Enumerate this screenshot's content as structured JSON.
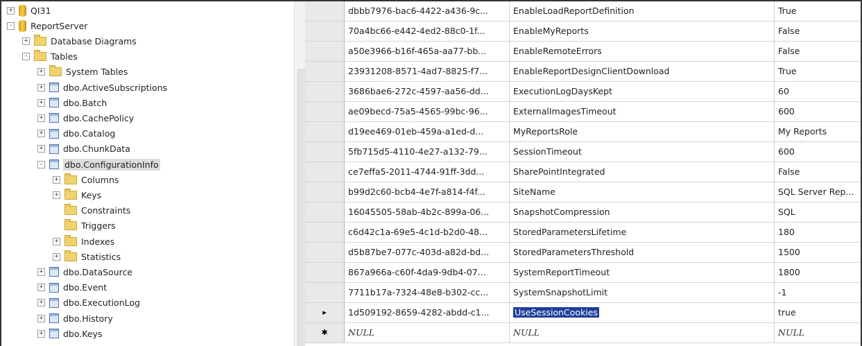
{
  "tree": {
    "nodes": [
      {
        "label": "QI31",
        "icon": "database-icon",
        "expander": "+",
        "indent": 0
      },
      {
        "label": "ReportServer",
        "icon": "database-icon",
        "expander": "-",
        "indent": 0
      },
      {
        "label": "Database Diagrams",
        "icon": "folder-icon",
        "expander": "+",
        "indent": 1
      },
      {
        "label": "Tables",
        "icon": "folder-icon",
        "expander": "-",
        "indent": 1
      },
      {
        "label": "System Tables",
        "icon": "folder-icon",
        "expander": "+",
        "indent": 2
      },
      {
        "label": "dbo.ActiveSubscriptions",
        "icon": "table-icon",
        "expander": "+",
        "indent": 2
      },
      {
        "label": "dbo.Batch",
        "icon": "table-icon",
        "expander": "+",
        "indent": 2
      },
      {
        "label": "dbo.CachePolicy",
        "icon": "table-icon",
        "expander": "+",
        "indent": 2
      },
      {
        "label": "dbo.Catalog",
        "icon": "table-icon",
        "expander": "+",
        "indent": 2
      },
      {
        "label": "dbo.ChunkData",
        "icon": "table-icon",
        "expander": "+",
        "indent": 2
      },
      {
        "label": "dbo.ConfigurationInfo",
        "icon": "table-icon",
        "expander": "-",
        "indent": 2,
        "selected": true
      },
      {
        "label": "Columns",
        "icon": "folder-icon",
        "expander": "+",
        "indent": 3
      },
      {
        "label": "Keys",
        "icon": "folder-icon",
        "expander": "+",
        "indent": 3
      },
      {
        "label": "Constraints",
        "icon": "folder-icon",
        "expander": "",
        "indent": 3
      },
      {
        "label": "Triggers",
        "icon": "folder-icon",
        "expander": "",
        "indent": 3
      },
      {
        "label": "Indexes",
        "icon": "folder-icon",
        "expander": "+",
        "indent": 3
      },
      {
        "label": "Statistics",
        "icon": "folder-icon",
        "expander": "+",
        "indent": 3
      },
      {
        "label": "dbo.DataSource",
        "icon": "table-icon",
        "expander": "+",
        "indent": 2
      },
      {
        "label": "dbo.Event",
        "icon": "table-icon",
        "expander": "+",
        "indent": 2
      },
      {
        "label": "dbo.ExecutionLog",
        "icon": "table-icon",
        "expander": "+",
        "indent": 2
      },
      {
        "label": "dbo.History",
        "icon": "table-icon",
        "expander": "+",
        "indent": 2
      },
      {
        "label": "dbo.Keys",
        "icon": "table-icon",
        "expander": "+",
        "indent": 2
      }
    ]
  },
  "grid": {
    "rows": [
      {
        "marker": "",
        "id": "dbbb7976-bac6-4422-a436-9c...",
        "name": "EnableLoadReportDefinition",
        "value": "True"
      },
      {
        "marker": "",
        "id": "70a4bc66-e442-4ed2-88c0-1f...",
        "name": "EnableMyReports",
        "value": "False"
      },
      {
        "marker": "",
        "id": "a50e3966-b16f-465a-aa77-bb...",
        "name": "EnableRemoteErrors",
        "value": "False"
      },
      {
        "marker": "",
        "id": "23931208-8571-4ad7-8825-f7...",
        "name": "EnableReportDesignClientDownload",
        "value": "True"
      },
      {
        "marker": "",
        "id": "3686bae6-272c-4597-aa56-dd...",
        "name": "ExecutionLogDaysKept",
        "value": "60"
      },
      {
        "marker": "",
        "id": "ae09becd-75a5-4565-99bc-96...",
        "name": "ExternalImagesTimeout",
        "value": "600"
      },
      {
        "marker": "",
        "id": "d19ee469-01eb-459a-a1ed-d...",
        "name": "MyReportsRole",
        "value": "My Reports"
      },
      {
        "marker": "",
        "id": "5fb715d5-4110-4e27-a132-79...",
        "name": "SessionTimeout",
        "value": "600"
      },
      {
        "marker": "",
        "id": "ce7effa5-2011-4744-91ff-3dd...",
        "name": "SharePointIntegrated",
        "value": "False"
      },
      {
        "marker": "",
        "id": "b99d2c60-bcb4-4e7f-a814-f4f...",
        "name": "SiteName",
        "value": "SQL Server Rep..."
      },
      {
        "marker": "",
        "id": "16045505-58ab-4b2c-899a-06...",
        "name": "SnapshotCompression",
        "value": "SQL"
      },
      {
        "marker": "",
        "id": "c6d42c1a-69e5-4c1d-b2d0-48...",
        "name": "StoredParametersLifetime",
        "value": "180"
      },
      {
        "marker": "",
        "id": "d5b87be7-077c-403d-a82d-bd...",
        "name": "StoredParametersThreshold",
        "value": "1500"
      },
      {
        "marker": "",
        "id": "867a966a-c60f-4da9-9db4-07...",
        "name": "SystemReportTimeout",
        "value": "1800"
      },
      {
        "marker": "",
        "id": "7711b17a-7324-48e8-b302-cc...",
        "name": "SystemSnapshotLimit",
        "value": "-1"
      },
      {
        "marker": "▸",
        "id": "1d509192-8659-4282-abdd-c1...",
        "name": "UseSessionCookies",
        "value": "true",
        "editing": true
      },
      {
        "marker": "✱",
        "id": "NULL",
        "name": "NULL",
        "value": "NULL",
        "new_row": true
      }
    ]
  }
}
